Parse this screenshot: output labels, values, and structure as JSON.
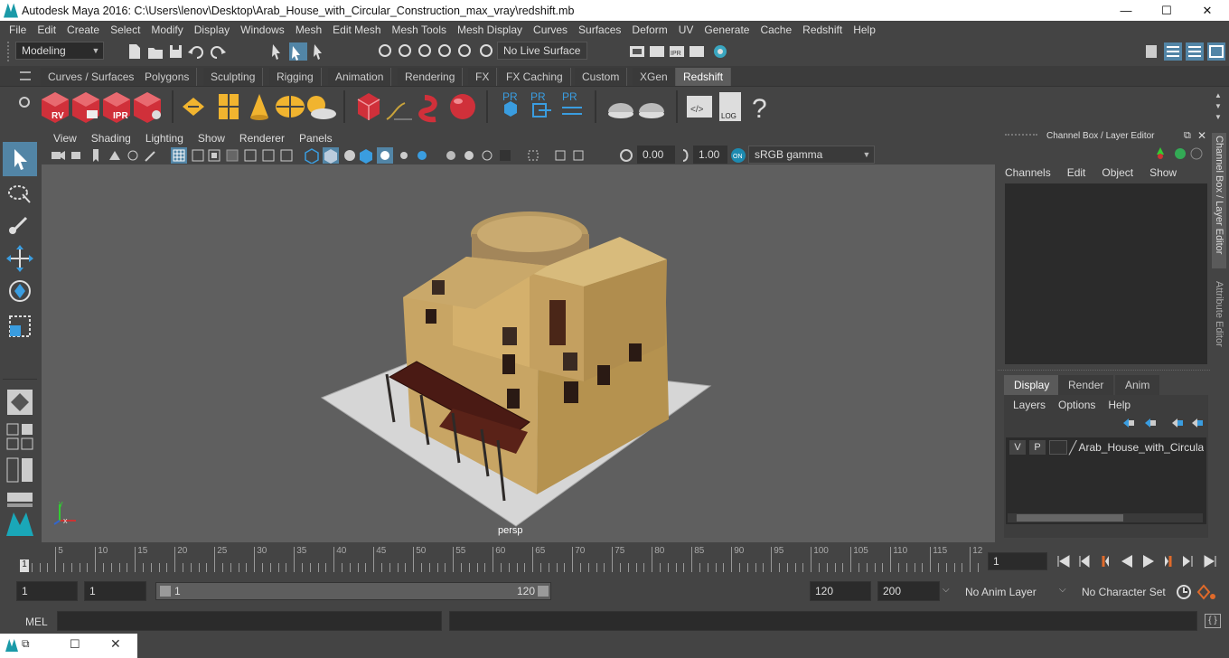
{
  "window": {
    "title": "Autodesk Maya 2016: C:\\Users\\lenov\\Desktop\\Arab_House_with_Circular_Construction_max_vray\\redshift.mb",
    "minimize": "—",
    "maximize": "☐",
    "close": "✕"
  },
  "menubar": {
    "items": [
      "File",
      "Edit",
      "Create",
      "Select",
      "Modify",
      "Display",
      "Windows",
      "Mesh",
      "Edit Mesh",
      "Mesh Tools",
      "Mesh Display",
      "Curves",
      "Surfaces",
      "Deform",
      "UV",
      "Generate",
      "Cache",
      "Redshift",
      "Help"
    ]
  },
  "status": {
    "mode": "Modeling",
    "live_surface": "No Live Surface"
  },
  "shelf": {
    "tabs": [
      "Curves / Surfaces",
      "Polygons",
      "Sculpting",
      "Rigging",
      "Animation",
      "Rendering",
      "FX",
      "FX Caching",
      "Custom",
      "XGen",
      "Redshift"
    ],
    "active_tab": "Redshift"
  },
  "viewport": {
    "menu": [
      "View",
      "Shading",
      "Lighting",
      "Show",
      "Renderer",
      "Panels"
    ],
    "exposure": "0.00",
    "gamma": "1.00",
    "color_space": "sRGB gamma",
    "camera_label": "persp"
  },
  "channelbox": {
    "title": "Channel Box / Layer Editor",
    "menu": [
      "Channels",
      "Edit",
      "Object",
      "Show"
    ],
    "layer_tabs": [
      "Display",
      "Render",
      "Anim"
    ],
    "active_layer_tab": "Display",
    "layer_menu": [
      "Layers",
      "Options",
      "Help"
    ],
    "layer": {
      "v": "V",
      "p": "P",
      "name": "Arab_House_with_Circula"
    }
  },
  "side_tabs": [
    "Channel Box / Layer Editor",
    "Attribute Editor"
  ],
  "timeline": {
    "ticks": [
      "5",
      "10",
      "15",
      "20",
      "25",
      "30",
      "35",
      "40",
      "45",
      "50",
      "55",
      "60",
      "65",
      "70",
      "75",
      "80",
      "85",
      "90",
      "95",
      "100",
      "105",
      "110",
      "115",
      "12"
    ],
    "start_label": "1",
    "current_frame": "1"
  },
  "range": {
    "start": "1",
    "playback_start": "1",
    "slider_start": "1",
    "slider_end": "120",
    "playback_end": "120",
    "end": "200",
    "anim_layer": "No Anim Layer",
    "char_set": "No Character Set"
  },
  "cmdline": {
    "label": "MEL"
  },
  "colors": {
    "bg": "#444444",
    "viewport": "#5f5f5f",
    "accent": "#5285a6",
    "redshift_red": "#d0303a",
    "maya_teal": "#1a9aa8"
  }
}
